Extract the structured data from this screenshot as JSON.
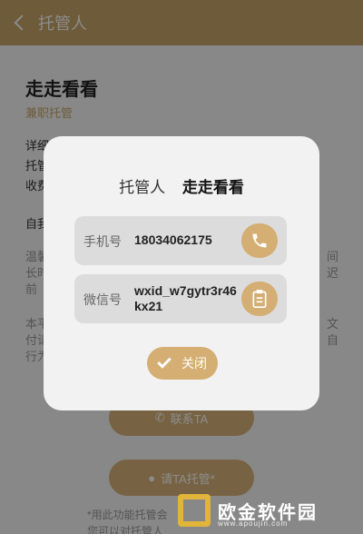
{
  "header": {
    "title": "托管人"
  },
  "profile": {
    "name": "走走看看",
    "role": "兼职托管"
  },
  "background_fragments": {
    "line1": "详细",
    "line2": "托管",
    "line3": "收费",
    "intro": "自我",
    "p1": "温馨",
    "p2": "长时",
    "p3": "前",
    "p4": "本平",
    "p5": "付请",
    "p6": "行为",
    "r1": "间",
    "r2": "迟",
    "r3": "文",
    "r4": "自"
  },
  "buttons": {
    "contact": "联系TA",
    "invite": "请TA托管*"
  },
  "notes": {
    "line1": "*用此功能托管会",
    "line2": "您可以对托管人"
  },
  "dialog": {
    "title_label": "托管人",
    "title_value": "走走看看",
    "phone_label": "手机号",
    "phone_value": "18034062175",
    "wechat_label": "微信号",
    "wechat_value": "wxid_w7gytr3r46kx21",
    "close_label": "关闭"
  },
  "watermark": {
    "name": "欧金软件园",
    "site": "www.apoujin.com"
  },
  "colors": {
    "accent": "#c9a66b",
    "button": "#d4ae72"
  }
}
